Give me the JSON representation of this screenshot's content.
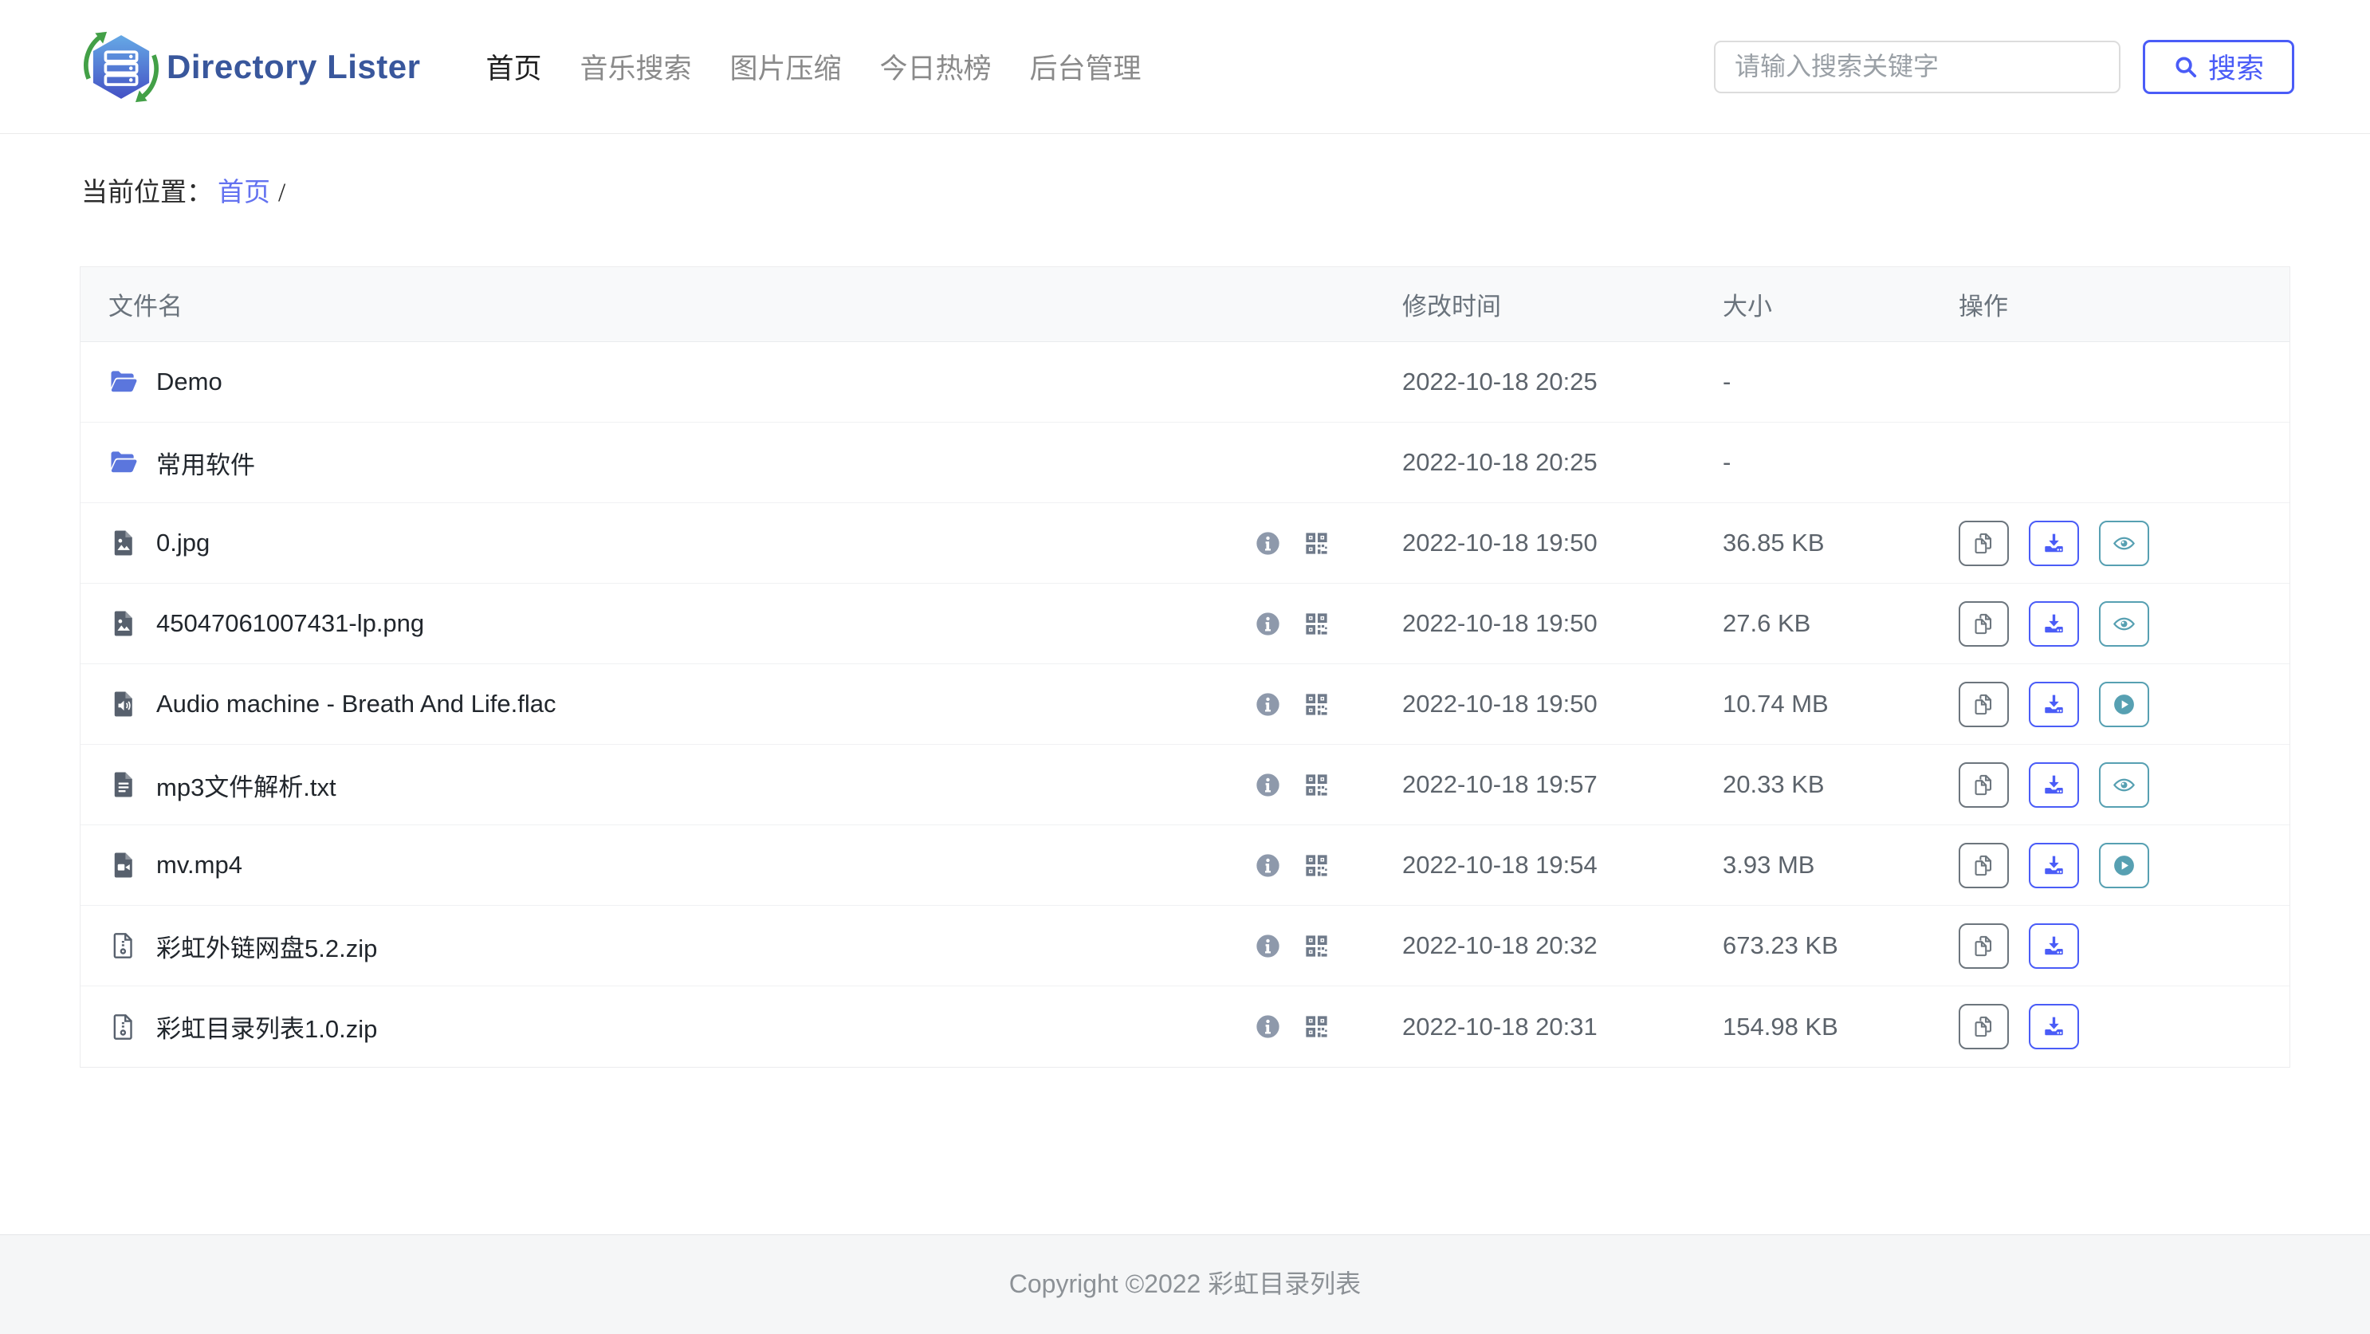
{
  "brand": {
    "name": "Directory Lister",
    "logo_icon": "directory-lister-logo"
  },
  "nav": {
    "items": [
      {
        "label": "首页",
        "active": true
      },
      {
        "label": "音乐搜索",
        "active": false
      },
      {
        "label": "图片压缩",
        "active": false
      },
      {
        "label": "今日热榜",
        "active": false
      },
      {
        "label": "后台管理",
        "active": false
      }
    ]
  },
  "search": {
    "placeholder": "请输入搜索关键字",
    "button_label": "搜索",
    "icon": "search-icon"
  },
  "breadcrumb": {
    "label": "当前位置：",
    "home": "首页",
    "separator": "/"
  },
  "table": {
    "headers": {
      "name": "文件名",
      "modified": "修改时间",
      "size": "大小",
      "actions": "操作"
    },
    "rows": [
      {
        "name": "Demo",
        "type": "folder",
        "icon": "folder-icon",
        "modified": "2022-10-18 20:25",
        "size": "-",
        "meta_icons": [],
        "actions": []
      },
      {
        "name": "常用软件",
        "type": "folder",
        "icon": "folder-icon",
        "modified": "2022-10-18 20:25",
        "size": "-",
        "meta_icons": [],
        "actions": []
      },
      {
        "name": "0.jpg",
        "type": "image",
        "icon": "image-file-icon",
        "modified": "2022-10-18 19:50",
        "size": "36.85 KB",
        "meta_icons": [
          "info-icon",
          "qrcode-icon"
        ],
        "actions": [
          "copy",
          "download",
          "preview"
        ]
      },
      {
        "name": "45047061007431-lp.png",
        "type": "image",
        "icon": "image-file-icon",
        "modified": "2022-10-18 19:50",
        "size": "27.6 KB",
        "meta_icons": [
          "info-icon",
          "qrcode-icon"
        ],
        "actions": [
          "copy",
          "download",
          "preview"
        ]
      },
      {
        "name": "Audio machine - Breath And Life.flac",
        "type": "audio",
        "icon": "audio-file-icon",
        "modified": "2022-10-18 19:50",
        "size": "10.74 MB",
        "meta_icons": [
          "info-icon",
          "qrcode-icon"
        ],
        "actions": [
          "copy",
          "download",
          "play"
        ]
      },
      {
        "name": "mp3文件解析.txt",
        "type": "text",
        "icon": "text-file-icon",
        "modified": "2022-10-18 19:57",
        "size": "20.33 KB",
        "meta_icons": [
          "info-icon",
          "qrcode-icon"
        ],
        "actions": [
          "copy",
          "download",
          "preview"
        ]
      },
      {
        "name": "mv.mp4",
        "type": "video",
        "icon": "video-file-icon",
        "modified": "2022-10-18 19:54",
        "size": "3.93 MB",
        "meta_icons": [
          "info-icon",
          "qrcode-icon"
        ],
        "actions": [
          "copy",
          "download",
          "play"
        ]
      },
      {
        "name": "彩虹外链网盘5.2.zip",
        "type": "zip",
        "icon": "zip-file-icon",
        "modified": "2022-10-18 20:32",
        "size": "673.23 KB",
        "meta_icons": [
          "info-icon",
          "qrcode-icon"
        ],
        "actions": [
          "copy",
          "download"
        ]
      },
      {
        "name": "彩虹目录列表1.0.zip",
        "type": "zip",
        "icon": "zip-file-icon",
        "modified": "2022-10-18 20:31",
        "size": "154.98 KB",
        "meta_icons": [
          "info-icon",
          "qrcode-icon"
        ],
        "actions": [
          "copy",
          "download"
        ]
      }
    ]
  },
  "footer": {
    "text": "Copyright ©2022 彩虹目录列表"
  },
  "colors": {
    "accent_blue": "#4a5cf7",
    "teal": "#57a0b2",
    "button_gray": "#6c757d",
    "folder_blue": "#5b76dd",
    "file_icon_gray": "#57606d",
    "link_blue": "#6372f0",
    "brand_navy": "#39579c",
    "logo_green": "#43a047",
    "footer_bg": "#f5f6f7",
    "table_header_bg": "#f8f9fa"
  }
}
